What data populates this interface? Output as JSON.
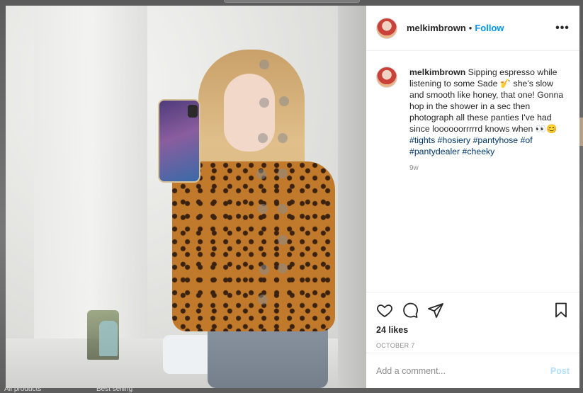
{
  "backdrop": {
    "bottom_left_text": "All products",
    "bottom_mid_text": "Best selling"
  },
  "post": {
    "username": "melkimbrown",
    "separator": "•",
    "follow_label": "Follow",
    "more_icon": "more-horizontal-icon",
    "caption": {
      "username": "melkimbrown",
      "text": " Sipping espresso while listening to some Sade 🎷 she's slow and smooth like honey, that one! Gonna hop in the shower in a sec then photograph all these panties I've had since loooooorrrrrd knows when 👀😊 ",
      "hashtags": [
        "#tights",
        "#hosiery",
        "#pantyhose",
        "#of",
        "#pantydealer",
        "#cheeky"
      ]
    },
    "time_ago": "9w",
    "likes": "24 likes",
    "date": "OCTOBER 7",
    "comment_placeholder": "Add a comment...",
    "post_label": "Post"
  },
  "icons": {
    "like": "heart-icon",
    "comment": "comment-icon",
    "share": "share-icon",
    "save": "bookmark-icon"
  },
  "colors": {
    "follow": "#0095f6",
    "post_disabled": "#b2dffc",
    "hashtag": "#00376b"
  }
}
